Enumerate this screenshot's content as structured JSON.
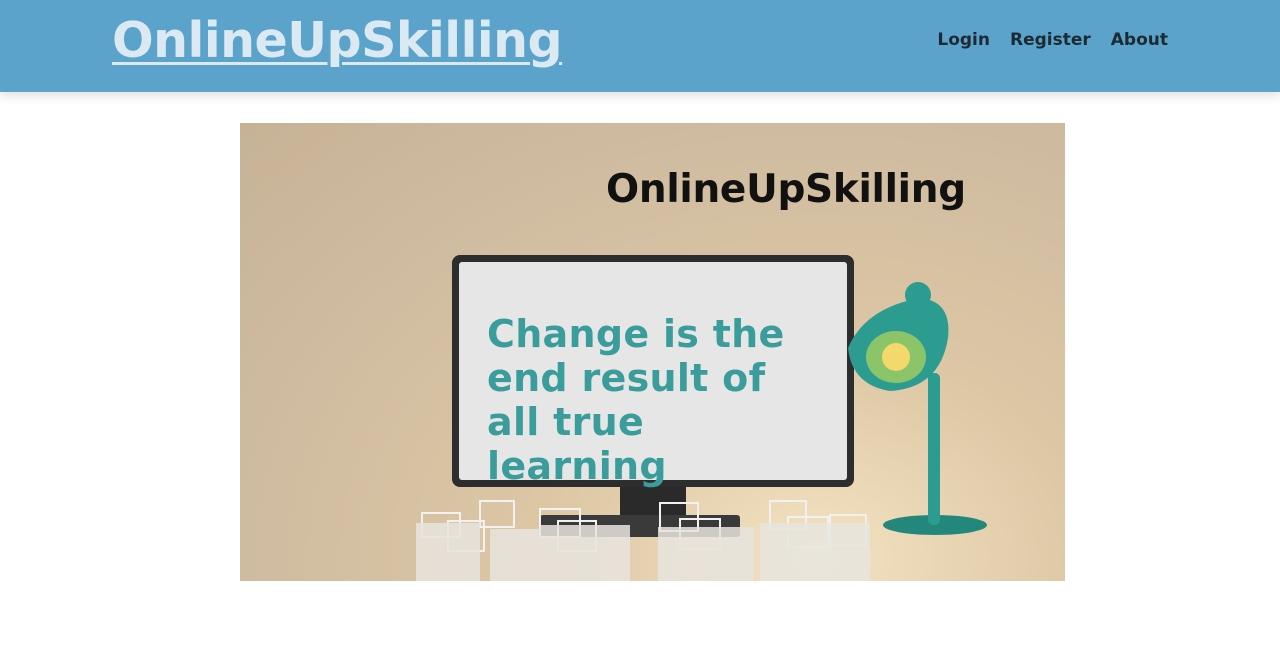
{
  "header": {
    "brand": "OnlineUpSkilling",
    "nav": [
      {
        "label": "Login"
      },
      {
        "label": "Register"
      },
      {
        "label": "About"
      }
    ]
  },
  "hero": {
    "title": "OnlineUpSkilling",
    "screen_text": "Change is the end result of all true learning"
  },
  "colors": {
    "header_bg": "#5ba3cb",
    "brand_text": "#dbe9f3",
    "screen_quote": "#3a9d9b",
    "lamp": "#2c9c90"
  }
}
